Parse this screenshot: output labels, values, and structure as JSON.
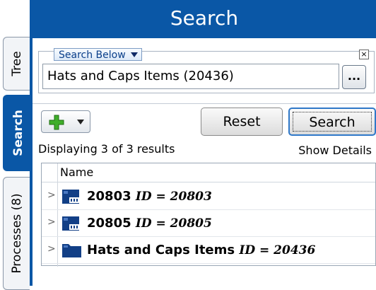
{
  "tabs": [
    {
      "label": "Tree"
    },
    {
      "label": "Search"
    },
    {
      "label": "Processes (8)"
    }
  ],
  "header": {
    "title": "Search"
  },
  "scope": {
    "mode_label": "Search Below",
    "value": "Hats and Caps Items (20436)",
    "browse_label": "...",
    "close_label": "×"
  },
  "toolbar": {
    "reset_label": "Reset",
    "search_label": "Search"
  },
  "results": {
    "status": "Displaying 3 of 3 results",
    "details_link": "Show Details",
    "column_name": "Name",
    "rows": [
      {
        "name": "20803",
        "id": "ID = 20803",
        "icon": "item-icon"
      },
      {
        "name": "20805",
        "id": "ID = 20805",
        "icon": "item-icon"
      },
      {
        "name": "Hats and Caps Items",
        "id": "ID = 20436",
        "icon": "folder-icon"
      }
    ]
  },
  "colors": {
    "accent": "#0a57a6",
    "add_green": "#3fae2a"
  }
}
